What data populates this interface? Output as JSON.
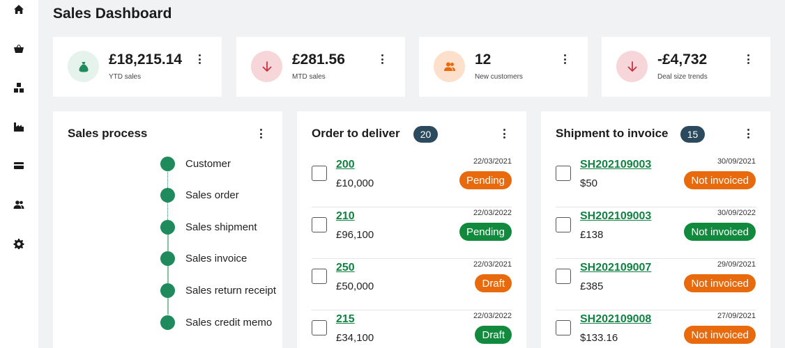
{
  "page_title": "Sales Dashboard",
  "sidebar": [
    {
      "name": "home-icon"
    },
    {
      "name": "basket-icon"
    },
    {
      "name": "boxes-icon"
    },
    {
      "name": "factory-icon"
    },
    {
      "name": "card-icon"
    },
    {
      "name": "people-icon"
    },
    {
      "name": "gear-icon"
    }
  ],
  "stats": [
    {
      "value": "£18,215.14",
      "label": "YTD sales",
      "icon": "money-bag-icon",
      "bg": "#e6f3ec",
      "fg": "#1f8a5b"
    },
    {
      "value": "£281.56",
      "label": "MTD sales",
      "icon": "arrow-down-icon",
      "bg": "#f6d6d9",
      "fg": "#c8323f"
    },
    {
      "value": "12",
      "label": "New customers",
      "icon": "people-icon",
      "bg": "#fce0cc",
      "fg": "#e86a0c"
    },
    {
      "value": "-£4,732",
      "label": "Deal size trends",
      "icon": "arrow-down-icon",
      "bg": "#f6d6d9",
      "fg": "#c8323f"
    }
  ],
  "sales_process": {
    "title": "Sales process",
    "steps": [
      "Customer",
      "Sales order",
      "Sales shipment",
      "Sales invoice",
      "Sales return receipt",
      "Sales credit memo"
    ]
  },
  "order_to_deliver": {
    "title": "Order to deliver",
    "count": "20",
    "rows": [
      {
        "id": "200",
        "amount": "£10,000",
        "date": "22/03/2021",
        "status": "Pending",
        "color": "orange"
      },
      {
        "id": "210",
        "amount": "£96,100",
        "date": "22/03/2022",
        "status": "Pending",
        "color": "green"
      },
      {
        "id": "250",
        "amount": "£50,000",
        "date": "22/03/2021",
        "status": "Draft",
        "color": "orange"
      },
      {
        "id": "215",
        "amount": "£34,100",
        "date": "22/03/2022",
        "status": "Draft",
        "color": "green"
      }
    ]
  },
  "shipment_to_invoice": {
    "title": "Shipment to invoice",
    "count": "15",
    "rows": [
      {
        "id": "SH202109003",
        "amount": "$50",
        "date": "30/09/2021",
        "status": "Not invoiced",
        "color": "orange"
      },
      {
        "id": "SH202109003",
        "amount": "£138",
        "date": "30/09/2022",
        "status": "Not invoiced",
        "color": "green"
      },
      {
        "id": "SH202109007",
        "amount": "£385",
        "date": "29/09/2021",
        "status": "Not invoiced",
        "color": "orange"
      },
      {
        "id": "SH202109008",
        "amount": "$133.16",
        "date": "27/09/2021",
        "status": "Not invoiced",
        "color": "orange"
      }
    ]
  }
}
